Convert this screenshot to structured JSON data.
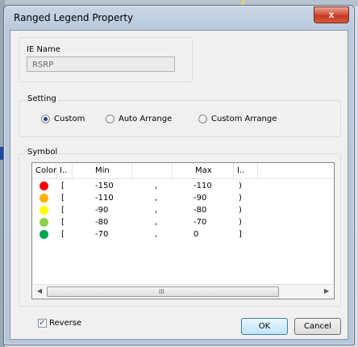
{
  "window": {
    "title": "Ranged Legend Property",
    "close_glyph": "x"
  },
  "ie_name": {
    "label": "IE Name",
    "value": "RSRP"
  },
  "setting": {
    "label": "Setting",
    "options": [
      {
        "label": "Custom",
        "selected": true
      },
      {
        "label": "Auto Arrange",
        "selected": false
      },
      {
        "label": "Custom Arrange",
        "selected": false
      }
    ]
  },
  "symbol": {
    "label": "Symbol",
    "columns": [
      "Color",
      "I..",
      "Min",
      "",
      "Max",
      "I.."
    ],
    "rows": [
      {
        "color": "#ff0000",
        "open": "[",
        "min": "-150",
        "sep": ",",
        "max": "-110",
        "close": ")"
      },
      {
        "color": "#ffb000",
        "open": "[",
        "min": "-110",
        "sep": ",",
        "max": "-90",
        "close": ")"
      },
      {
        "color": "#ffff00",
        "open": "[",
        "min": "-90",
        "sep": ",",
        "max": "-80",
        "close": ")"
      },
      {
        "color": "#8ccf46",
        "open": "[",
        "min": "-80",
        "sep": ",",
        "max": "-70",
        "close": ")"
      },
      {
        "color": "#00a651",
        "open": "[",
        "min": "-70",
        "sep": ",",
        "max": "0",
        "close": "]"
      }
    ],
    "scroll_grip": "III"
  },
  "footer": {
    "reverse_label": "Reverse",
    "reverse_checked": true,
    "ok_label": "OK",
    "cancel_label": "Cancel"
  }
}
